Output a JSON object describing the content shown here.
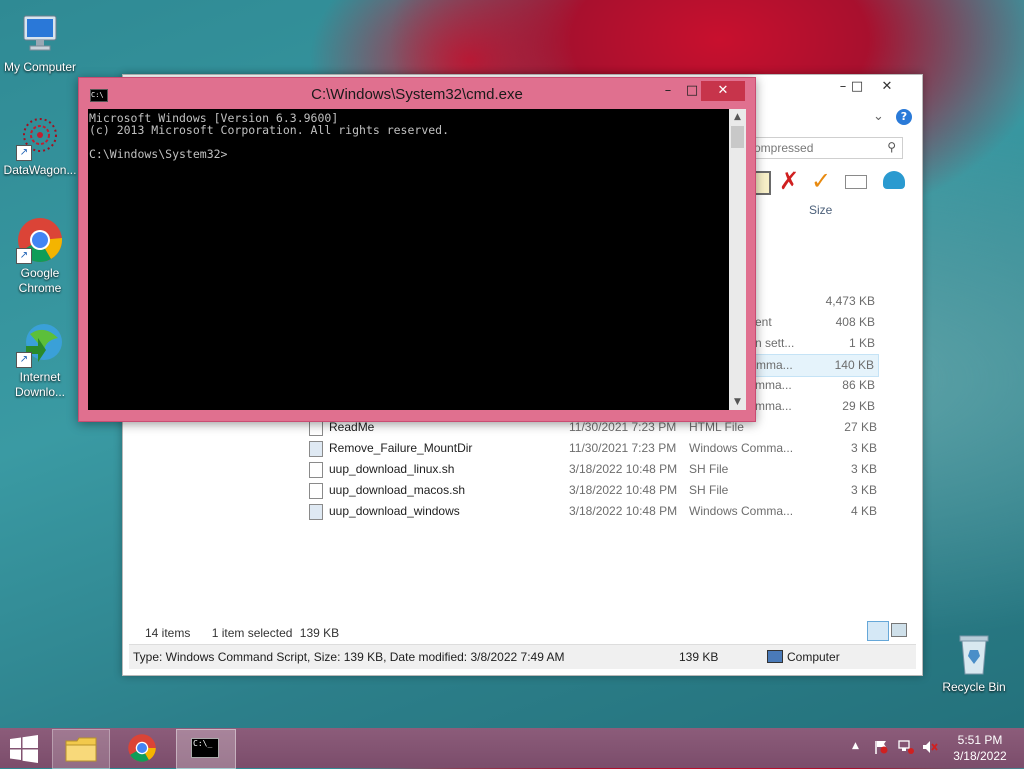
{
  "desktop": {
    "icons": [
      {
        "label": "My Computer",
        "icon": "computer-icon"
      },
      {
        "label": "DataWagon...",
        "icon": "datawagon-icon"
      },
      {
        "label": "Google Chrome",
        "icon": "chrome-icon"
      },
      {
        "label": "Internet Downlo...",
        "icon": "idm-icon"
      },
      {
        "label": "Recycle Bin",
        "icon": "recycle-bin-icon"
      }
    ]
  },
  "cmd": {
    "title": "C:\\Windows\\System32\\cmd.exe",
    "lines": [
      "Microsoft Windows [Version 6.3.9600]",
      "(c) 2013 Microsoft Corporation. All rights reserved.",
      "",
      "C:\\Windows\\System32>"
    ]
  },
  "explorer": {
    "search_placeholder": "ompressed",
    "column_size": "Size",
    "partial_rows": [
      {
        "type": "",
        "size": "4,473 KB"
      },
      {
        "type": "ent",
        "size": "408 KB"
      },
      {
        "type": "n sett...",
        "size": "1 KB"
      },
      {
        "type": "mma...",
        "size": "140 KB"
      },
      {
        "type": "mma...",
        "size": "86 KB"
      },
      {
        "type": "mma...",
        "size": "29 KB"
      }
    ],
    "files": [
      {
        "name": "ReadMe",
        "date": "11/30/2021 7:23 PM",
        "type": "HTML File",
        "size": "27 KB"
      },
      {
        "name": "Remove_Failure_MountDir",
        "date": "11/30/2021 7:23 PM",
        "type": "Windows Comma...",
        "size": "3 KB"
      },
      {
        "name": "uup_download_linux.sh",
        "date": "3/18/2022 10:48 PM",
        "type": "SH File",
        "size": "3 KB"
      },
      {
        "name": "uup_download_macos.sh",
        "date": "3/18/2022 10:48 PM",
        "type": "SH File",
        "size": "3 KB"
      },
      {
        "name": "uup_download_windows",
        "date": "3/18/2022 10:48 PM",
        "type": "Windows Comma...",
        "size": "4 KB"
      }
    ],
    "items_count": "14 items",
    "selected": "1 item selected",
    "selected_size": "139 KB",
    "status_type": "Type: Windows Command Script, Size: 139 KB, Date modified: 3/8/2022 7:49 AM",
    "status_size": "139 KB",
    "status_location": "Computer"
  },
  "taskbar": {
    "time": "5:51 PM",
    "date": "3/18/2022"
  }
}
